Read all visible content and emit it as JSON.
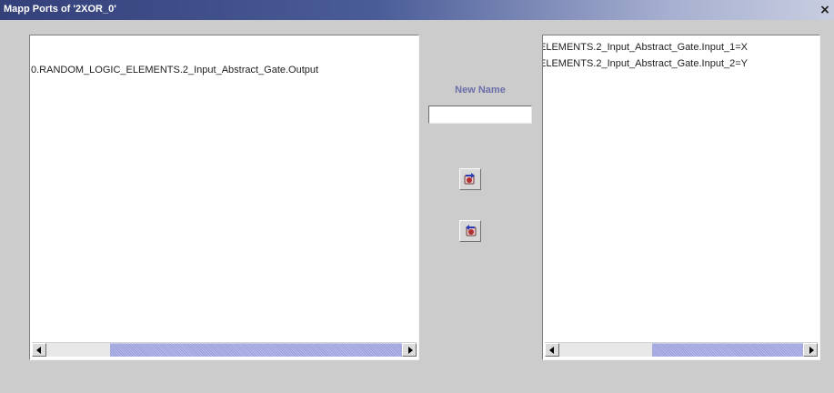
{
  "window": {
    "title": "Mapp Ports of '2XOR_0'",
    "close_glyph": "×",
    "titlebar_color_dark": "#34407a",
    "titlebar_color_light": "#c8cde0",
    "background": "#cccccc"
  },
  "left_list": {
    "items": [
      "0.RANDOM_LOGIC_ELEMENTS.2_Input_Abstract_Gate.Output"
    ],
    "hscroll": {
      "left_arrow_icon": "arrow-left-icon",
      "right_arrow_icon": "arrow-right-icon"
    }
  },
  "center": {
    "new_name_label": "New Name",
    "new_name_value": "",
    "map_button_icon": "map-port-icon",
    "unmap_button_icon": "unmap-port-icon",
    "label_color": "#6b6ea8"
  },
  "right_list": {
    "items": [
      "ELEMENTS.2_Input_Abstract_Gate.Input_1=X",
      "ELEMENTS.2_Input_Abstract_Gate.Input_2=Y"
    ],
    "hscroll": {
      "left_arrow_icon": "arrow-left-icon",
      "right_arrow_icon": "arrow-right-icon"
    }
  },
  "scroll_thumb_color": "#9a9fd8"
}
